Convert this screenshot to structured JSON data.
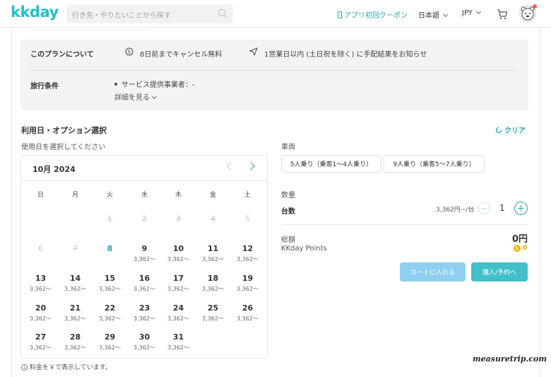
{
  "header": {
    "logo": "kkday",
    "search_placeholder": "行き先・やりたいことから探す",
    "coupon": "アプリ初回クーポン",
    "language": "日本語",
    "currency": "JPY"
  },
  "info": {
    "about_label": "このプランについて",
    "cancel_text": "8日前までキャンセル無料",
    "notice_text": "1営業日以内 (土日祝を除く) に手配結果をお知らせ",
    "terms_label": "旅行条件",
    "provider_text": "サービス提供事業者：-",
    "details_link": "詳細を見る"
  },
  "section": {
    "title": "利用日・オプション選択",
    "clear": "クリア",
    "date_prompt": "使用日を選択してください"
  },
  "calendar": {
    "month": "10月 2024",
    "weekdays": [
      "日",
      "月",
      "火",
      "水",
      "木",
      "金",
      "土"
    ],
    "past_row": [
      "1",
      "2",
      "3",
      "4",
      "5"
    ],
    "row2_past": [
      "6",
      "7"
    ],
    "today": "8",
    "price": "3,362～",
    "row2_avail": [
      "9",
      "10",
      "11",
      "12"
    ],
    "row3": [
      "13",
      "14",
      "15",
      "16",
      "17",
      "18",
      "19"
    ],
    "row4": [
      "20",
      "21",
      "22",
      "23",
      "24",
      "25",
      "26"
    ],
    "row5": [
      "27",
      "28",
      "29",
      "30",
      "31"
    ]
  },
  "vehicle": {
    "label": "車両",
    "options": [
      "5人乗り（乗客1〜4人乗り）",
      "9人乗り（乗客5〜7人乗り）"
    ]
  },
  "quantity": {
    "label": "数量",
    "item": "台数",
    "unit_price": "3,362円~/台",
    "value": "1"
  },
  "total": {
    "label": "総額",
    "value": "0円",
    "points_label": "KKday Points",
    "points_value": "0",
    "coin_glyph": "L"
  },
  "buttons": {
    "cart": "カートに入れる",
    "buy": "購入/予約へ"
  },
  "note": "料金を￥で表示しています。",
  "watermark": "measuretrip.com",
  "colors": {
    "accent": "#26a5b0",
    "brand": "#26bec9",
    "cart_button": "#8fd0f0",
    "buy_button": "#42c0ca",
    "points": "#e0a800"
  }
}
